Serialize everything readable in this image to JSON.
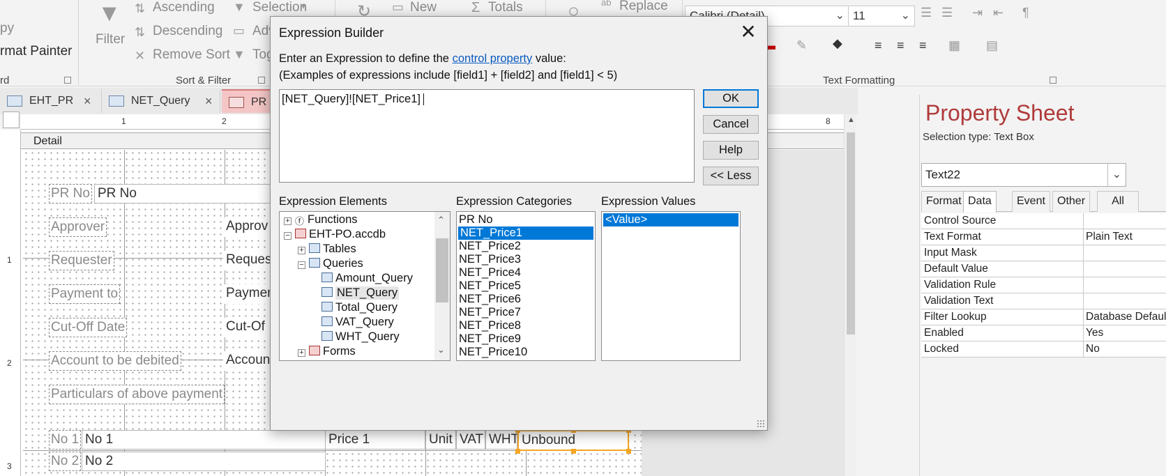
{
  "ribbon": {
    "clipboard": {
      "copy": "py",
      "format_painter": "rmat Painter",
      "group": "rd"
    },
    "sort_filter": {
      "filter": "Filter",
      "ascending": "Ascending",
      "descending": "Descending",
      "remove_sort": "Remove Sort",
      "selection": "Selection",
      "advanced": "Adv",
      "toggle": "Tog",
      "group": "Sort & Filter"
    },
    "records": {
      "new": "New",
      "totals": "Totals"
    },
    "find": {
      "replace": "Replace"
    },
    "text_formatting": {
      "font": "Calibri (Detail)",
      "size": "11",
      "group": "Text Formatting"
    }
  },
  "tabs": [
    {
      "label": "EHT_PR"
    },
    {
      "label": "NET_Query"
    },
    {
      "label": "PR"
    }
  ],
  "design": {
    "section": "Detail",
    "ruler_marks": [
      "1",
      "2",
      "8"
    ],
    "vruler_marks": [
      "1",
      "2",
      "3"
    ],
    "labels": [
      "PR No",
      "Approver",
      "Requester",
      "Payment to",
      "Cut-Off Date",
      "Account to be debited",
      "Particulars of above payment",
      "No 1",
      "No 2"
    ],
    "textboxes": [
      "PR No",
      "Approv",
      "Reques",
      "Paymen",
      "Cut-Of",
      "Accoun",
      "No 1",
      "No 2",
      "Price 1",
      "Unit",
      "VAT",
      "WHT",
      "Unbound"
    ]
  },
  "property_sheet": {
    "title": "Property Sheet",
    "selection_type": "Selection type:  Text Box",
    "selected_control": "Text22",
    "tabs": [
      "Format",
      "Data",
      "Event",
      "Other",
      "All"
    ],
    "active_tab": "Data",
    "rows": [
      {
        "key": "Control Source",
        "value": ""
      },
      {
        "key": "Text Format",
        "value": "Plain Text"
      },
      {
        "key": "Input Mask",
        "value": ""
      },
      {
        "key": "Default Value",
        "value": ""
      },
      {
        "key": "Validation Rule",
        "value": ""
      },
      {
        "key": "Validation Text",
        "value": ""
      },
      {
        "key": "Filter Lookup",
        "value": "Database Default"
      },
      {
        "key": "Enabled",
        "value": "Yes"
      },
      {
        "key": "Locked",
        "value": "No"
      }
    ]
  },
  "dialog": {
    "title": "Expression Builder",
    "instruction_prefix": "Enter an Expression to define the",
    "instruction_link": "control property",
    "instruction_suffix": "value:",
    "examples": "(Examples of expressions include [field1] + [field2] and [field1] < 5)",
    "expression": "[NET_Query]![NET_Price1]",
    "buttons": {
      "ok": "OK",
      "cancel": "Cancel",
      "help": "Help",
      "less": "<< Less"
    },
    "elements_label": "Expression Elements",
    "categories_label": "Expression Categories",
    "values_label": "Expression Values",
    "elements": {
      "functions": "Functions",
      "db": "EHT-PO.accdb",
      "tables": "Tables",
      "queries": "Queries",
      "query_items": [
        "Amount_Query",
        "NET_Query",
        "Total_Query",
        "VAT_Query",
        "WHT_Query"
      ],
      "forms": "Forms"
    },
    "categories": [
      "PR No",
      "NET_Price1",
      "NET_Price2",
      "NET_Price3",
      "NET_Price4",
      "NET_Price5",
      "NET_Price6",
      "NET_Price7",
      "NET_Price8",
      "NET_Price9",
      "NET_Price10"
    ],
    "selected_category": "NET_Price1",
    "values": [
      "<Value>"
    ]
  },
  "colors": {
    "accent": "#0078d7",
    "property_title": "#b03a3a",
    "selection_outline": "#f5a623",
    "active_tab": "#f4c6c6"
  }
}
